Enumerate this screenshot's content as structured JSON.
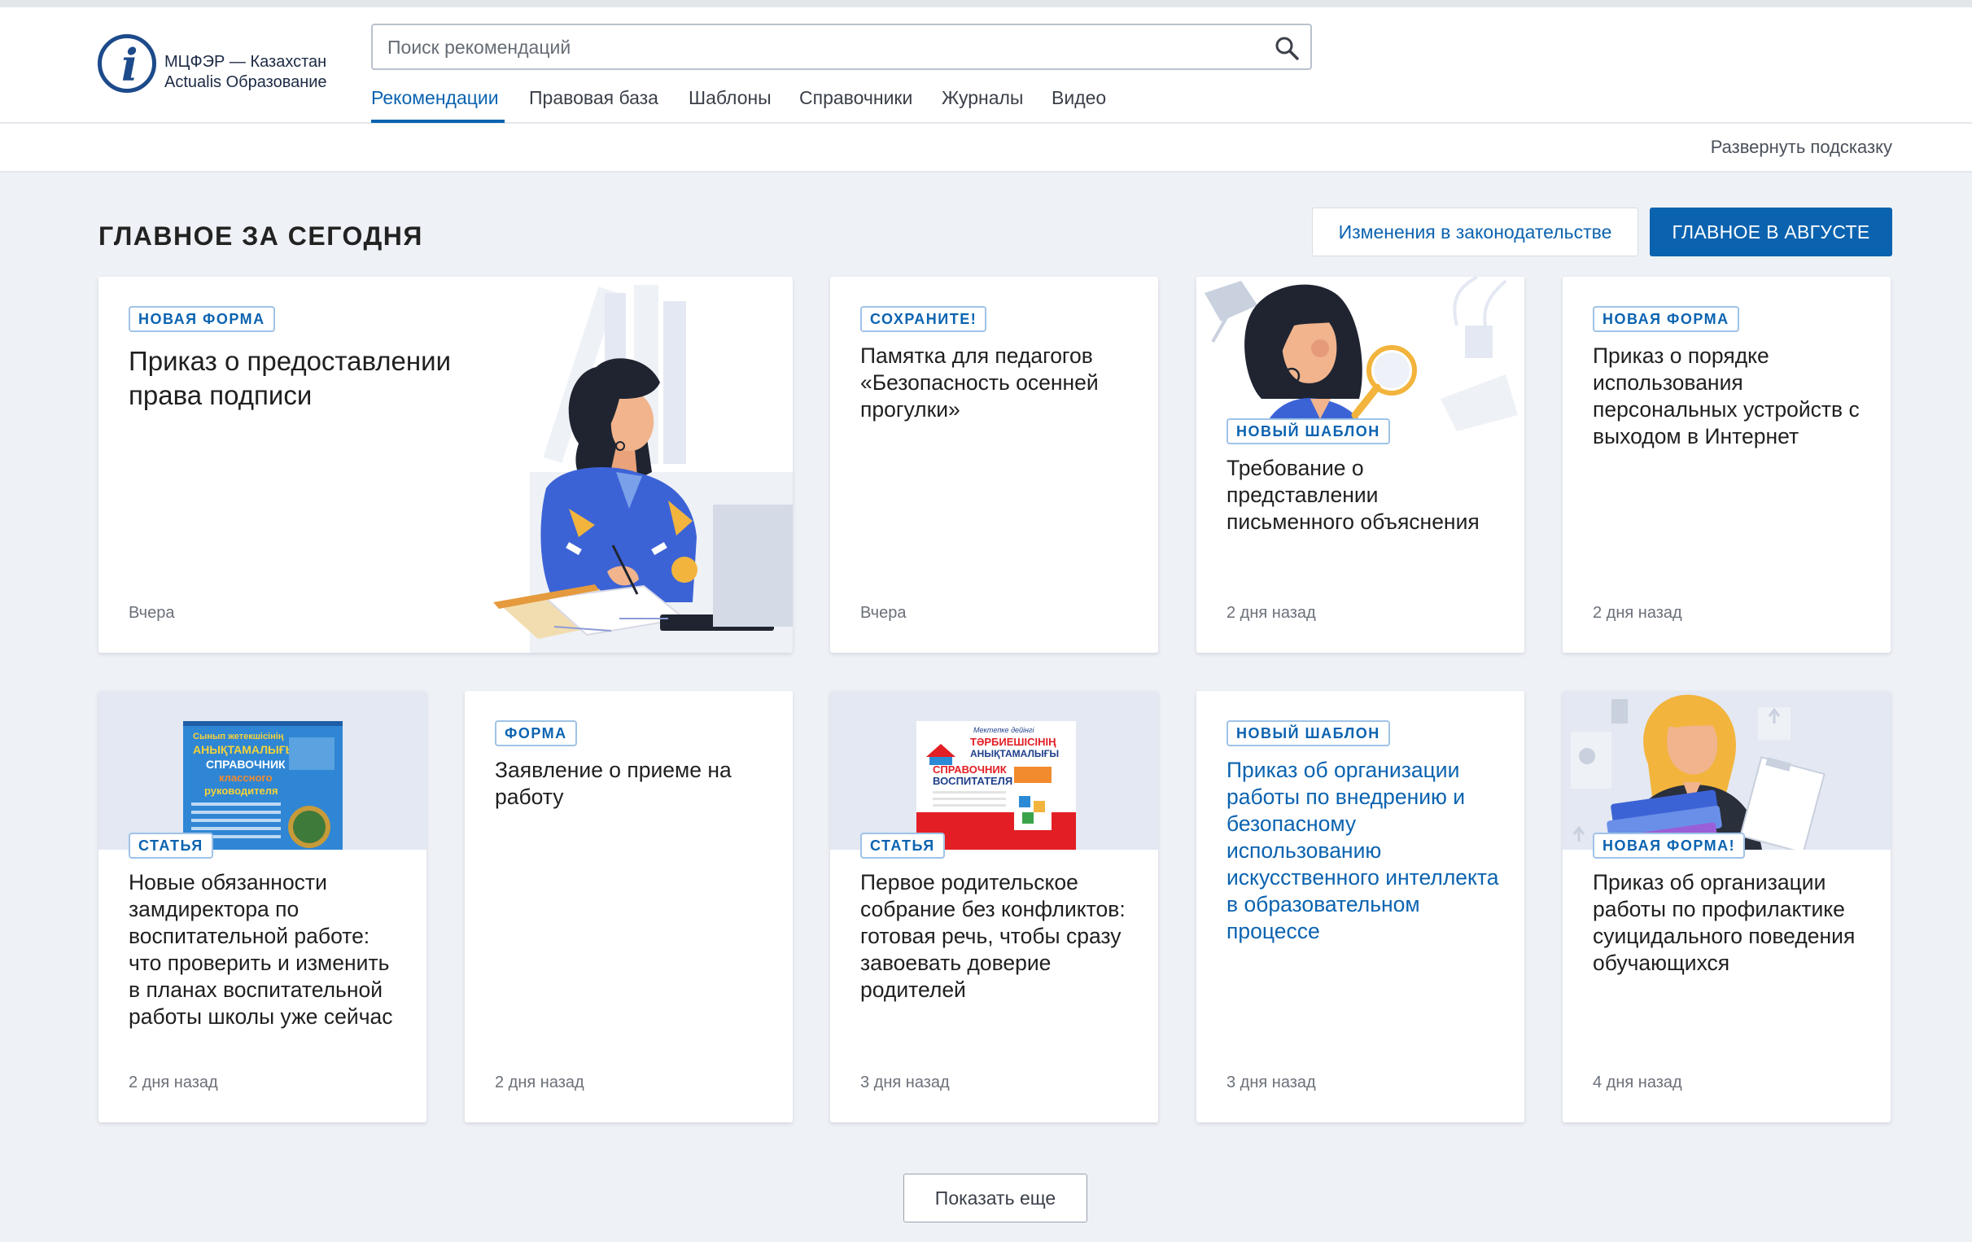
{
  "header": {
    "logo_line1": "МЦФЭР — Казахстан",
    "logo_line2": "Actualis Образование",
    "search_placeholder": "Поиск рекомендаций",
    "nav": [
      "Рекомендации",
      "Правовая база",
      "Шаблоны",
      "Справочники",
      "Журналы",
      "Видео"
    ],
    "active_nav": "Рекомендации"
  },
  "hint": {
    "expand_label": "Развернуть подсказку"
  },
  "section": {
    "title": "ГЛАВНОЕ ЗА СЕГОДНЯ",
    "btn_changes": "Изменения в законодательстве",
    "btn_month": "ГЛАВНОЕ В АВГУСТЕ"
  },
  "cards": [
    {
      "badge": "НОВАЯ ФОРМА",
      "title": "Приказ о предоставлении права подписи",
      "date": "Вчера",
      "illustration": "woman-writing"
    },
    {
      "badge": "СОХРАНИТЕ!",
      "title": "Памятка для педагогов «Безопасность осенней прогулки»",
      "date": "Вчера"
    },
    {
      "badge": "НОВЫЙ ШАБЛОН",
      "title": "Требование о представлении письменного объяснения",
      "date": "2 дня назад",
      "illustration": "woman-magnifier"
    },
    {
      "badge": "НОВАЯ ФОРМА",
      "title": "Приказ о порядке использования персональных устройств с выходом в Интернет",
      "date": "2 дня назад"
    },
    {
      "badge": "СТАТЬЯ",
      "title": "Новые обязанности замдиректора по воспитательной работе: что проверить и изменить в планах воспитательной работы школы уже сейчас",
      "date": "2 дня назад",
      "illustration": "book-cover-blue"
    },
    {
      "badge": "ФОРМА",
      "title": "Заявление о приеме на работу",
      "date": "2 дня назад"
    },
    {
      "badge": "СТАТЬЯ",
      "title": "Первое родительское собрание без конфликтов: готовая речь, чтобы сразу завоевать доверие родителей",
      "date": "3 дня назад",
      "illustration": "book-cover-red"
    },
    {
      "badge": "НОВЫЙ ШАБЛОН",
      "title": "Приказ об организации работы по внедрению и безопасному использованию искусственного интеллекта в образовательном процессе",
      "date": "3 дня назад",
      "title_color": "#0b63b0"
    },
    {
      "badge": "НОВАЯ ФОРМА!",
      "title": "Приказ об организации работы по профилактике суицидального поведения обучающихся",
      "date": "4 дня назад",
      "illustration": "woman-books"
    }
  ],
  "covers": {
    "blue": {
      "line1": "Сынып жетекшісінің",
      "line2": "АНЫҚТАМАЛЫҒЫ",
      "line3": "СПРАВОЧНИК",
      "line4": "классного",
      "line5": "руководителя"
    },
    "red": {
      "line1": "Мектепке дейінгі",
      "line2": "ТӘРБИЕШІСІНІҢ",
      "line3": "АНЫҚТАМАЛЫҒЫ",
      "line4": "СПРАВОЧНИК",
      "line5": "ВОСПИТАТЕЛЯ"
    }
  },
  "show_more": "Показать еще",
  "colors": {
    "accent": "#0b63b0",
    "background": "#eef1f6",
    "badge_border": "#9fc3e7"
  }
}
